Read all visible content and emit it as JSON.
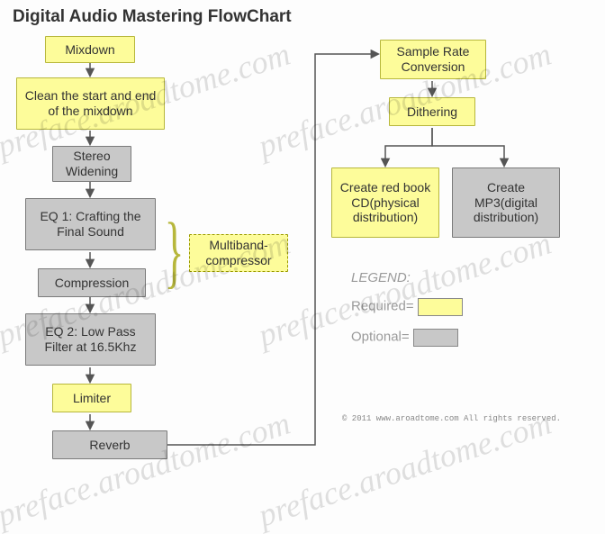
{
  "title": "Digital Audio Mastering FlowChart",
  "left": {
    "mixdown": "Mixdown",
    "clean": "Clean the start and end of the mixdown",
    "stereo": "Stereo Widening",
    "eq1": "EQ 1: Crafting the Final Sound",
    "compression": "Compression",
    "eq2": "EQ 2: Low Pass Filter at 16.5Khz",
    "limiter": "Limiter",
    "reverb": "Reverb"
  },
  "annotation": {
    "multiband": "Multiband-compressor"
  },
  "right": {
    "src": "Sample Rate Conversion",
    "dithering": "Dithering",
    "redbook": "Create red book CD(physical distribution)",
    "mp3": "Create MP3(digital distribution)"
  },
  "legend": {
    "title": "LEGEND:",
    "required": "Required=",
    "optional": "Optional="
  },
  "copyright": "© 2011 www.aroadtome.com All rights reserved.",
  "watermark": "preface.aroadtome.com"
}
